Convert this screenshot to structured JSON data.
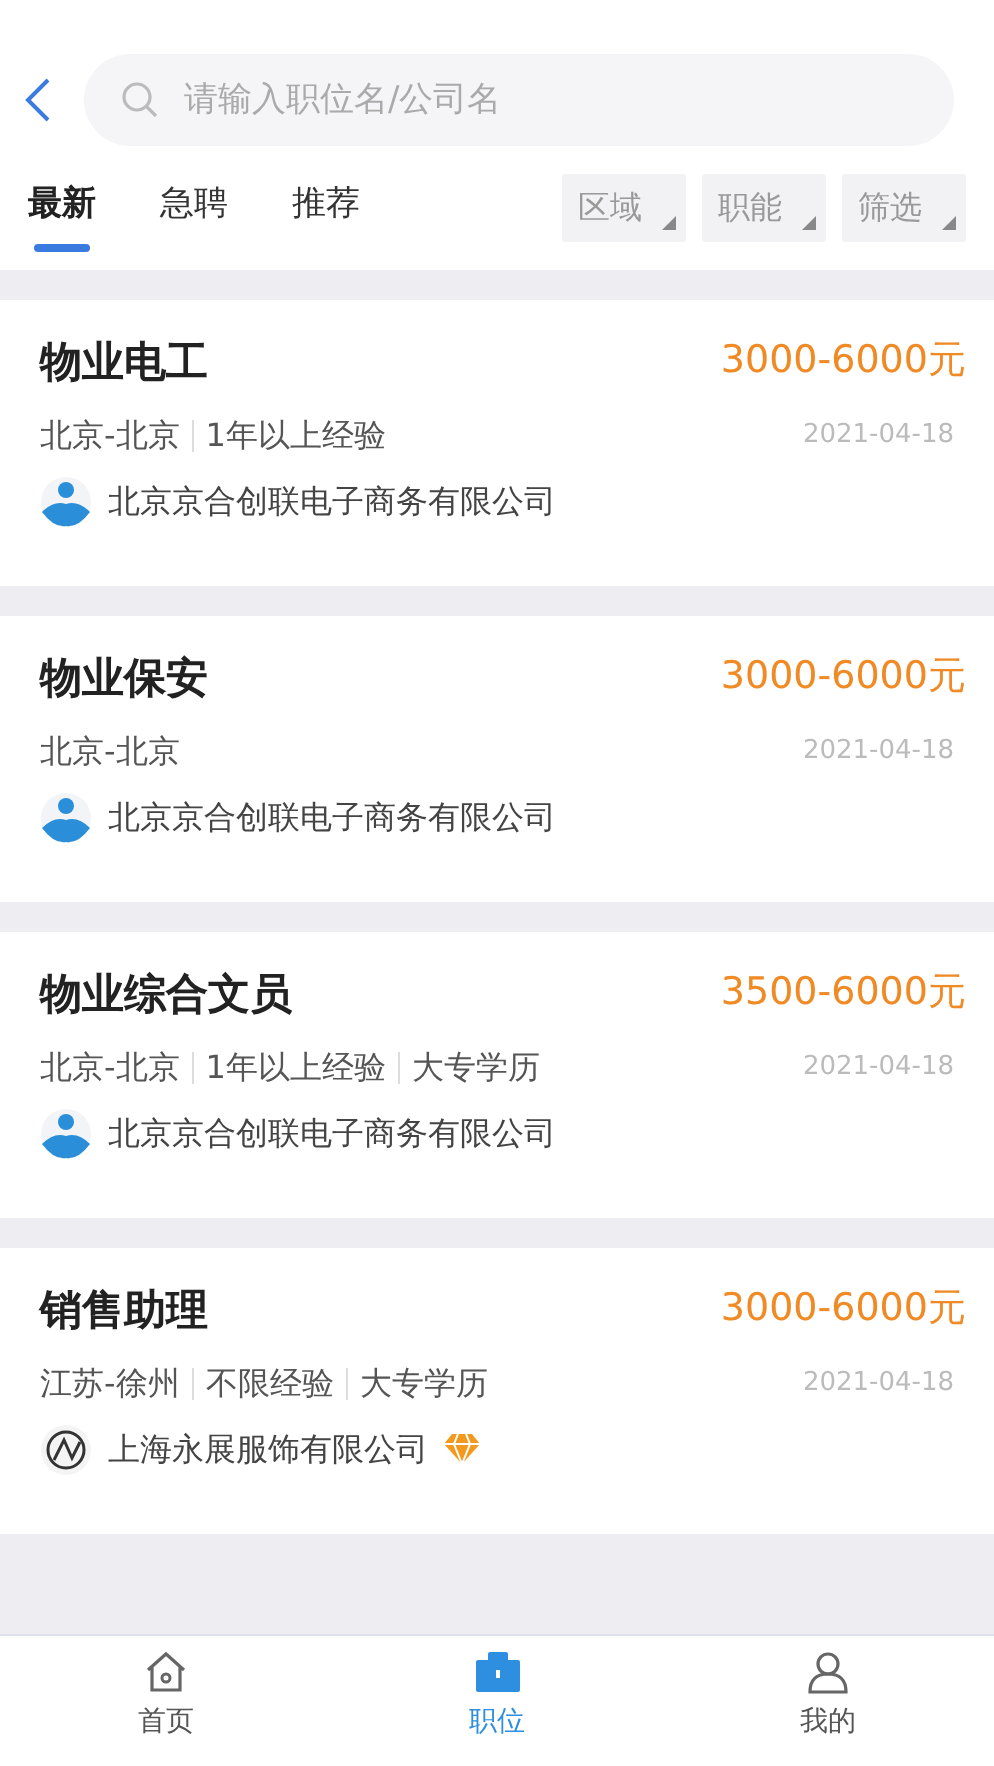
{
  "search": {
    "placeholder": "请输入职位名/公司名"
  },
  "tabs": [
    {
      "label": "最新",
      "selected": true
    },
    {
      "label": "急聘",
      "selected": false
    },
    {
      "label": "推荐",
      "selected": false
    }
  ],
  "filters": [
    "区域",
    "职能",
    "筛选"
  ],
  "jobs": [
    {
      "title": "物业电工",
      "salary": "3000-6000元",
      "tags": [
        "北京-北京",
        "1年以上经验"
      ],
      "date": "2021-04-18",
      "company": "北京京合创联电子商务有限公司",
      "kind": "person",
      "vip": false
    },
    {
      "title": "物业保安",
      "salary": "3000-6000元",
      "tags": [
        "北京-北京"
      ],
      "date": "2021-04-18",
      "company": "北京京合创联电子商务有限公司",
      "kind": "person",
      "vip": false
    },
    {
      "title": "物业综合文员",
      "salary": "3500-6000元",
      "tags": [
        "北京-北京",
        "1年以上经验",
        "大专学历"
      ],
      "date": "2021-04-18",
      "company": "北京京合创联电子商务有限公司",
      "kind": "person",
      "vip": false
    },
    {
      "title": "销售助理",
      "salary": "3000-6000元",
      "tags": [
        "江苏-徐州",
        "不限经验",
        "大专学历"
      ],
      "date": "2021-04-18",
      "company": "上海永展服饰有限公司",
      "kind": "mark",
      "vip": true
    }
  ],
  "nav": [
    {
      "label": "首页",
      "selected": false
    },
    {
      "label": "职位",
      "selected": true
    },
    {
      "label": "我的",
      "selected": false
    }
  ]
}
